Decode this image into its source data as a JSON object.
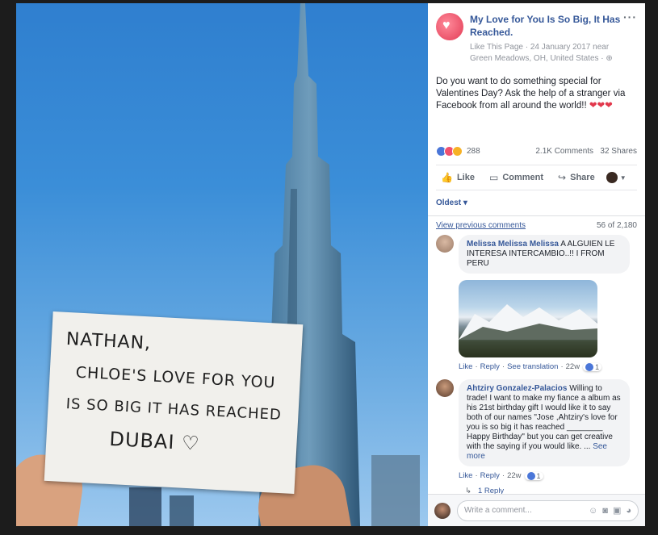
{
  "photo": {
    "sign_lines": [
      "NATHAN,",
      "CHLOE'S LOVE FOR YOU",
      "IS SO BIG IT HAS REACHED",
      "DUBAI ♡"
    ]
  },
  "post": {
    "page_name": "My Love for You Is So Big, It Has Reached.",
    "like_page": "Like This Page",
    "meta_rest": "· 24 January 2017 near Green Meadows, OH, United States ·",
    "globe_icon": "globe-icon",
    "body": "Do you want to do something special for Valentines Day? Ask the help of a stranger via Facebook from all around the world!!",
    "hearts": "❤❤❤"
  },
  "stats": {
    "reaction_count": "288",
    "comments": "2.1K Comments",
    "shares": "32 Shares"
  },
  "actions": {
    "like": "Like",
    "comment": "Comment",
    "share": "Share"
  },
  "comments_section": {
    "sort_label": "Oldest ▾",
    "view_previous": "View previous comments",
    "count": "56 of 2,180",
    "items": [
      {
        "name": "Melissa Melissa Melissa",
        "text": "A ALGUIEN LE INTERESA INTERCAMBIO..!! I FROM PERU",
        "like": "Like",
        "reply": "Reply",
        "extra": "See translation",
        "time": "22w",
        "likes": "1"
      },
      {
        "name": "Ahtziry Gonzalez-Palacios",
        "text": "Willing to trade! I want to make my fiance a album as his 21st birthday gift I would like it to say both of our names \"Jose ,Ahtziry's love for you is so big it has reached ________ Happy Birthday\" but you can get creative with the saying if you would like. ...",
        "see_more": "See more",
        "like": "Like",
        "reply": "Reply",
        "time": "22w",
        "likes": "1",
        "replies": "1 Reply"
      }
    ]
  },
  "composer": {
    "placeholder": "Write a comment..."
  },
  "colors": {
    "link": "#365899",
    "like_blue": "#4a76d8",
    "love_red": "#f0506e"
  }
}
